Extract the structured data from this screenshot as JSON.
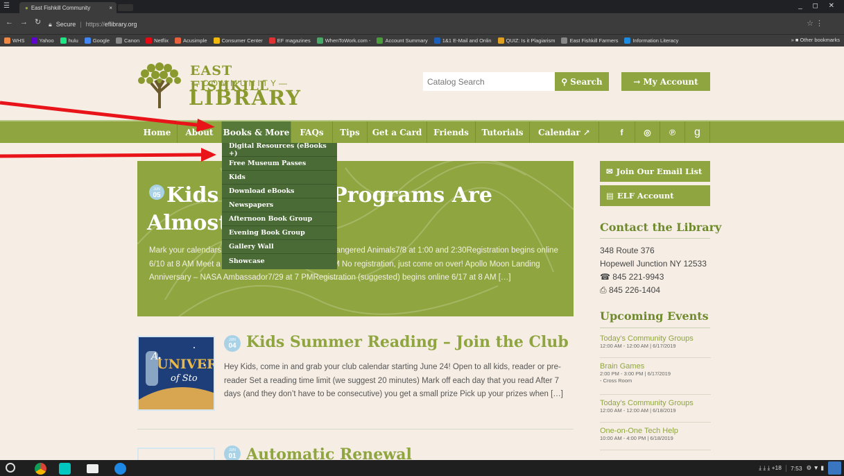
{
  "browser": {
    "tab_title": "East Fishkill Community",
    "tab_close": "×",
    "secure_label": "Secure",
    "url_proto": "https://",
    "url_host": "eflibrary.org",
    "window_controls": "_ ◻ ✕",
    "bookmarks": [
      {
        "label": "WHS",
        "color": "#ee8844"
      },
      {
        "label": "Yahoo",
        "color": "#6001d2"
      },
      {
        "label": "hulu",
        "color": "#1ce783"
      },
      {
        "label": "Google",
        "color": "#4285f4"
      },
      {
        "label": "Canon",
        "color": "#888888"
      },
      {
        "label": "Netflix",
        "color": "#e50914"
      },
      {
        "label": "Acusimple",
        "color": "#e8603c"
      },
      {
        "label": "Consumer Center",
        "color": "#f2b90c"
      },
      {
        "label": "EF magazines",
        "color": "#d33"
      },
      {
        "label": "WhenToWork.com - ",
        "color": "#4a6"
      },
      {
        "label": "Account Summary",
        "color": "#4a9b3a"
      },
      {
        "label": "1&1 E-Mail and Onlin",
        "color": "#1c5fb8"
      },
      {
        "label": "QUIZ: Is it Plagiarism",
        "color": "#e0a020"
      },
      {
        "label": "East Fishkill Farmers",
        "color": "#888888"
      },
      {
        "label": "Information Literacy",
        "color": "#1c8be0"
      }
    ],
    "other_bookmarks": "» ■ Other bookmarks"
  },
  "logo": {
    "line1": "EAST FISHKILL",
    "line2": "—COMMUNITY—",
    "line3": "LIBRARY"
  },
  "search": {
    "placeholder": "Catalog Search",
    "button": "Search",
    "account": "My Account"
  },
  "nav": [
    {
      "label": "Home",
      "name": "nav-home"
    },
    {
      "label": "About",
      "name": "nav-about"
    },
    {
      "label": "Books & More",
      "name": "nav-books-more"
    },
    {
      "label": "FAQs",
      "name": "nav-faqs"
    },
    {
      "label": "Tips",
      "name": "nav-tips"
    },
    {
      "label": "Get a Card",
      "name": "nav-get-a-card"
    },
    {
      "label": "Friends",
      "name": "nav-friends"
    },
    {
      "label": "Tutorials",
      "name": "nav-tutorials"
    },
    {
      "label": "Calendar ↗",
      "name": "nav-calendar"
    }
  ],
  "social": [
    "f",
    "◎",
    "℗",
    "g"
  ],
  "dropdown": [
    "Digital Resources (eBooks +)",
    "Free Museum Passes",
    "Kids",
    "Download eBooks",
    "Newspapers",
    "Afternoon Book Group",
    "Evening Book Group",
    "Gallery Wall",
    "Showcase"
  ],
  "hero": {
    "month": "JUN",
    "day": "05",
    "title": "Kids Summer Programs Are Almost Here!",
    "text": "Mark your calendars for: Threatened, Exotic and Endangered Animals7/8 at 1:00 and 2:30Registration begins online 6/10 at 8 AM Meet a Children’s Author7/15 at 6:30 PM No registration, just come on over! Apollo Moon Landing Anniversary – NASA Ambassador7/29 at 7 PMRegistration (suggested) begins online 6/17 at 8 AM […]"
  },
  "post2": {
    "month": "JUN",
    "day": "04",
    "title": "Kids Summer Reading – Join the Club",
    "text": "Hey Kids, come in and grab your club calendar starting June 24! Open to all kids, reader or pre-reader Set a reading time limit (we suggest 20 minutes) Mark off each day that you read After 7 days (and they don’t have to be consecutive) you get a small prize Pick up your prizes when […]",
    "img_text1": "UNIVERSE",
    "img_text2": "of Sto",
    "img_text3": "A"
  },
  "post3": {
    "month": "JUN",
    "day": "01",
    "title": "Automatic Renewal"
  },
  "sidebar": {
    "email_btn": "Join Our Email List",
    "elf_btn": "ELF Account",
    "contact_heading": "Contact the Library",
    "address1": "348 Route 376",
    "address2": "Hopewell Junction NY 12533",
    "phone": "845 221-9943",
    "fax": "845 226-1404",
    "events_heading": "Upcoming Events",
    "events": [
      {
        "title": "Today's Community Groups",
        "detail": "12:00 AM - 12:00 AM | 6/17/2019",
        "detail2": ""
      },
      {
        "title": "Brain Games",
        "detail": "2:00 PM - 3:00 PM | 6/17/2019",
        "detail2": "- Cross Room"
      },
      {
        "title": "Today's Community Groups",
        "detail": "12:00 AM - 12:00 AM | 6/18/2019",
        "detail2": ""
      },
      {
        "title": "One-on-One Tech Help",
        "detail": "10:00 AM - 4:00 PM | 6/18/2019",
        "detail2": ""
      }
    ]
  },
  "taskbar": {
    "downloads": "⤓ ⤓ ⤓ +18",
    "time": "7:53",
    "status": "⚙ ▼ ▮"
  },
  "colors": {
    "brand_green": "#8fa540",
    "dark_green": "#4a6b35",
    "active_nav": "#567838",
    "arrow_red": "#e8141a"
  }
}
